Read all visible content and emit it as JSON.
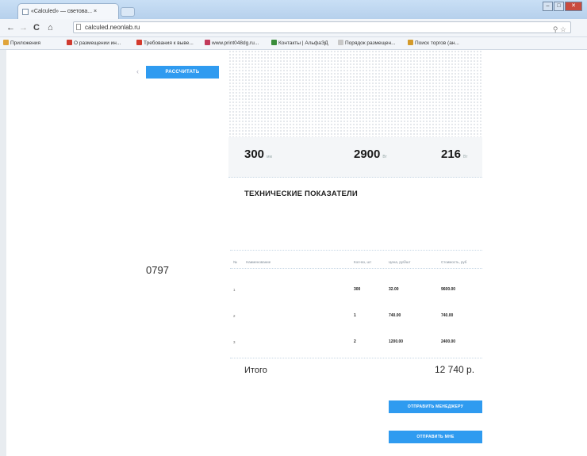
{
  "browser": {
    "tab_title": "«Calculed» — светова... ×",
    "address": "calculed.neonlab.ru",
    "nav": {
      "back": "←",
      "forward": "→",
      "reload": "C",
      "home": "⌂"
    },
    "bookmarks": [
      {
        "label": "Приложения",
        "color": "#e0a43a"
      },
      {
        "label": "О размещении ин...",
        "color": "#d03b2f"
      },
      {
        "label": "Требования к выве...",
        "color": "#d43a2c"
      },
      {
        "label": "www.print048dg.ru...",
        "color": "#c23a5a"
      },
      {
        "label": "Контакты | АльфаЭД",
        "color": "#3b8d3b"
      },
      {
        "label": "Порядок размещен...",
        "color": "#c8c8c8"
      },
      {
        "label": "Поиск торгов (ан...",
        "color": "#d49a2a"
      }
    ]
  },
  "calculator": {
    "calc_button": "РАССЧИТАТЬ"
  },
  "stats": [
    {
      "value": "300",
      "unit": "мм"
    },
    {
      "value": "2900",
      "unit": "Вт"
    },
    {
      "value": "216",
      "unit": "Вт"
    }
  ],
  "tech": {
    "title": "ТЕХНИЧЕСКИЕ ПОКАЗАТЕЛИ"
  },
  "order": {
    "number": "0797"
  },
  "table": {
    "headers": [
      "№",
      "Наименование",
      "Кол-во, шт",
      "Цена, руб/шт",
      "Стоимость, руб"
    ],
    "rows": [
      {
        "num": "1",
        "name": "",
        "qty": "300",
        "price": "32.00",
        "cost": "9600.00"
      },
      {
        "num": "2",
        "name": "",
        "qty": "1",
        "price": "740.00",
        "cost": "740.00"
      },
      {
        "num": "3",
        "name": "",
        "qty": "2",
        "price": "1200.00",
        "cost": "2400.00"
      }
    ]
  },
  "total": {
    "label": "Итого",
    "value": "12 740 р."
  },
  "actions": {
    "send_manager": "ОТПРАВИТЬ МЕНЕДЖЕРУ",
    "send_me": "ОТПРАВИТЬ МНЕ"
  }
}
